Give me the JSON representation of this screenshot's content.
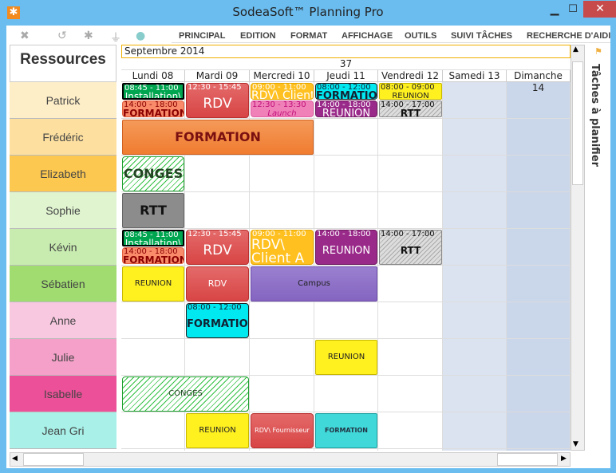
{
  "window": {
    "title": "SodeaSoft™ Planning Pro",
    "min": "▁",
    "max": "☐",
    "close": "✕",
    "icon": "✱"
  },
  "toolbar": {
    "icons": [
      "close-icon",
      "refresh-icon",
      "settings-icon",
      "plug-icon",
      "status-dot-icon"
    ],
    "glyphs": [
      "✖",
      "↺",
      "✱",
      "⏚",
      "●"
    ]
  },
  "menu": [
    "PRINCIPAL",
    "EDITION",
    "FORMAT",
    "AFFICHAGE",
    "OUTILS",
    "SUIVI TÂCHES",
    "RECHERCHE D'AIDI"
  ],
  "resources_title": "Ressources",
  "resources": [
    {
      "name": "Patrick",
      "color": "#fdeec8"
    },
    {
      "name": "Frédéric",
      "color": "#fde0a0"
    },
    {
      "name": "Elizabeth",
      "color": "#fdc850"
    },
    {
      "name": "Sophie",
      "color": "#e0f4d0"
    },
    {
      "name": "Kévin",
      "color": "#c8ecb0"
    },
    {
      "name": "Sébatien",
      "color": "#a0dc70"
    },
    {
      "name": "Anne",
      "color": "#f8c8e0"
    },
    {
      "name": "Julie",
      "color": "#f4a0c8"
    },
    {
      "name": "Isabelle",
      "color": "#ec5098"
    },
    {
      "name": "Jean Gri",
      "color": "#a8f0e8"
    }
  ],
  "month": "Septembre 2014",
  "week": "37",
  "days": [
    "Lundi 08",
    "Mardi 09",
    "Mercredi 10",
    "Jeudi 11",
    "Vendredi 12",
    "Samedi 13",
    "Dimanche 14"
  ],
  "side_panel": "Tâches à planifier",
  "events": [
    {
      "r": 0,
      "d": 0,
      "span": 1,
      "part": "top",
      "time": "08:45 - 11:00",
      "label": "Installation\\",
      "style": "green"
    },
    {
      "r": 0,
      "d": 0,
      "span": 1,
      "part": "bottom",
      "time": "14:00 - 18:00",
      "label": "FORMATION",
      "style": "salmon"
    },
    {
      "r": 0,
      "d": 1,
      "span": 1,
      "part": "full",
      "time": "12:30 - 15:45",
      "label": "RDV",
      "style": "red"
    },
    {
      "r": 0,
      "d": 2,
      "span": 1,
      "part": "top",
      "time": "09:00 - 11:00",
      "label": "RDV\\ Client A",
      "style": "amber"
    },
    {
      "r": 0,
      "d": 2,
      "span": 1,
      "part": "bottom",
      "time": "12:30 - 13:30",
      "label": "Launch",
      "style": "pink"
    },
    {
      "r": 0,
      "d": 3,
      "span": 1,
      "part": "top",
      "time": "08:00 - 12:00",
      "label": "FORMATION",
      "style": "cyan"
    },
    {
      "r": 0,
      "d": 3,
      "span": 1,
      "part": "bottom",
      "time": "14:00 - 18:00",
      "label": "REUNION",
      "style": "purple"
    },
    {
      "r": 0,
      "d": 4,
      "span": 1,
      "part": "top",
      "time": "08:00 - 09:00",
      "label": "REUNION",
      "style": "yellow"
    },
    {
      "r": 0,
      "d": 4,
      "span": 1,
      "part": "bottom",
      "time": "14:00 - 17:00",
      "label": "RTT",
      "style": "hatch"
    },
    {
      "r": 1,
      "d": 0,
      "span": 3,
      "part": "full",
      "time": "",
      "label": "FORMATION",
      "style": "orange"
    },
    {
      "r": 2,
      "d": 0,
      "span": 1,
      "part": "full",
      "time": "",
      "label": "CONGES",
      "style": "conges"
    },
    {
      "r": 3,
      "d": 0,
      "span": 1,
      "part": "full",
      "time": "",
      "label": "RTT",
      "style": "gray"
    },
    {
      "r": 4,
      "d": 0,
      "span": 1,
      "part": "top",
      "time": "08:45 - 11:00",
      "label": "Installation\\",
      "style": "green"
    },
    {
      "r": 4,
      "d": 0,
      "span": 1,
      "part": "bottom",
      "time": "14:00 - 18:00",
      "label": "FORMATION",
      "style": "salmon"
    },
    {
      "r": 4,
      "d": 1,
      "span": 1,
      "part": "full",
      "time": "12:30 - 15:45",
      "label": "RDV",
      "style": "red"
    },
    {
      "r": 4,
      "d": 2,
      "span": 1,
      "part": "full",
      "time": "09:00 - 11:00",
      "label": "RDV\\ Client A",
      "style": "amber"
    },
    {
      "r": 4,
      "d": 3,
      "span": 1,
      "part": "full",
      "time": "14:00 - 18:00",
      "label": "REUNION",
      "style": "purple"
    },
    {
      "r": 4,
      "d": 4,
      "span": 1,
      "part": "full",
      "time": "14:00 - 17:00",
      "label": "RTT",
      "style": "hatch"
    },
    {
      "r": 5,
      "d": 0,
      "span": 1,
      "part": "full",
      "time": "",
      "label": "REUNION",
      "style": "yellowsm"
    },
    {
      "r": 5,
      "d": 1,
      "span": 1,
      "part": "full",
      "time": "",
      "label": "RDV",
      "style": "redsm"
    },
    {
      "r": 5,
      "d": 2,
      "span": 2,
      "part": "full",
      "time": "",
      "label": "Campus",
      "style": "lavender"
    },
    {
      "r": 6,
      "d": 1,
      "span": 1,
      "part": "full",
      "time": "08:00 - 12:00",
      "label": "FORMATION",
      "style": "cyan"
    },
    {
      "r": 7,
      "d": 3,
      "span": 1,
      "part": "full",
      "time": "",
      "label": "REUNION",
      "style": "yellowsm"
    },
    {
      "r": 8,
      "d": 0,
      "span": 2,
      "part": "full",
      "time": "",
      "label": "CONGES",
      "style": "congessm"
    },
    {
      "r": 9,
      "d": 1,
      "span": 1,
      "part": "full",
      "time": "",
      "label": "REUNION",
      "style": "yellowsm"
    },
    {
      "r": 9,
      "d": 2,
      "span": 1,
      "part": "full",
      "time": "",
      "label": "RDV\\ Fournisseur",
      "style": "redxs"
    },
    {
      "r": 9,
      "d": 3,
      "span": 1,
      "part": "full",
      "time": "",
      "label": "FORMATION",
      "style": "teal"
    }
  ]
}
